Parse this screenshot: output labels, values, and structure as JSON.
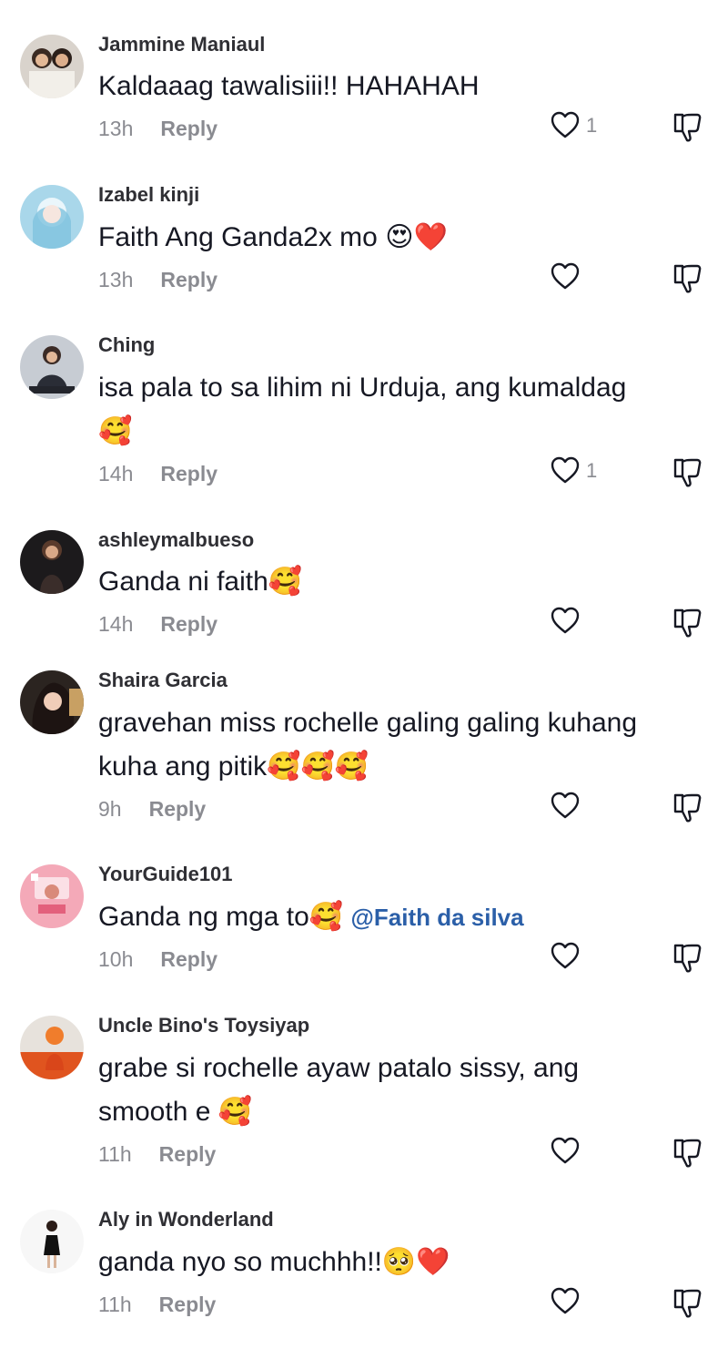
{
  "comments": [
    {
      "username": "Jammine Maniaul",
      "text": "Kaldaaag tawalisiii!! HAHAHAH",
      "emoji": "",
      "mention": "",
      "text_line2": "",
      "time": "13h",
      "reply_label": "Reply",
      "like_count": "1",
      "avatar": "two-women-photo"
    },
    {
      "username": "Izabel kinji",
      "text": "Faith Ang Ganda2x mo ",
      "emoji": "😍❤️",
      "mention": "",
      "text_line2": "",
      "time": "13h",
      "reply_label": "Reply",
      "like_count": "",
      "avatar": "anime-girl-photo"
    },
    {
      "username": "Ching",
      "text": "isa pala to sa lihim ni Urduja, ang kumaldag",
      "emoji": "",
      "mention": "",
      "text_line2": "🥰",
      "time": "14h",
      "reply_label": "Reply",
      "like_count": "1",
      "avatar": "sitting-woman-photo"
    },
    {
      "username": "ashleymalbueso",
      "text": "Ganda ni faith",
      "emoji": "🥰",
      "mention": "",
      "text_line2": "",
      "time": "14h",
      "reply_label": "Reply",
      "like_count": "",
      "avatar": "woman-dark-photo"
    },
    {
      "username": "Shaira Garcia",
      "text": "gravehan miss rochelle galing galing kuhang",
      "emoji": "",
      "mention": "",
      "text_line2": "kuha ang pitik🥰🥰🥰",
      "time": "9h",
      "reply_label": "Reply",
      "like_count": "",
      "avatar": "woman-selfie-photo"
    },
    {
      "username": "YourGuide101",
      "text": "Ganda ng mga to",
      "emoji": "🥰",
      "mention": "@Faith da silva",
      "text_line2": "",
      "time": "10h",
      "reply_label": "Reply",
      "like_count": "",
      "avatar": "pink-graphic-logo"
    },
    {
      "username": "Uncle Bino's Toysiyap",
      "text": "grabe si rochelle ayaw patalo sissy, ang",
      "emoji": "",
      "mention": "",
      "text_line2": "smooth e 🥰",
      "time": "11h",
      "reply_label": "Reply",
      "like_count": "",
      "avatar": "orange-figure-photo"
    },
    {
      "username": "Aly in Wonderland",
      "text": "ganda nyo so muchhh!!",
      "emoji": "🥺❤️",
      "mention": "",
      "text_line2": "",
      "time": "11h",
      "reply_label": "Reply",
      "like_count": "",
      "avatar": "woman-black-dress-photo"
    }
  ],
  "icons": {
    "like": "heart-outline-icon",
    "dislike": "thumbs-down-outline-icon"
  },
  "colors": {
    "text": "#161823",
    "muted": "#8a8b91",
    "mention": "#2b5fa8"
  }
}
